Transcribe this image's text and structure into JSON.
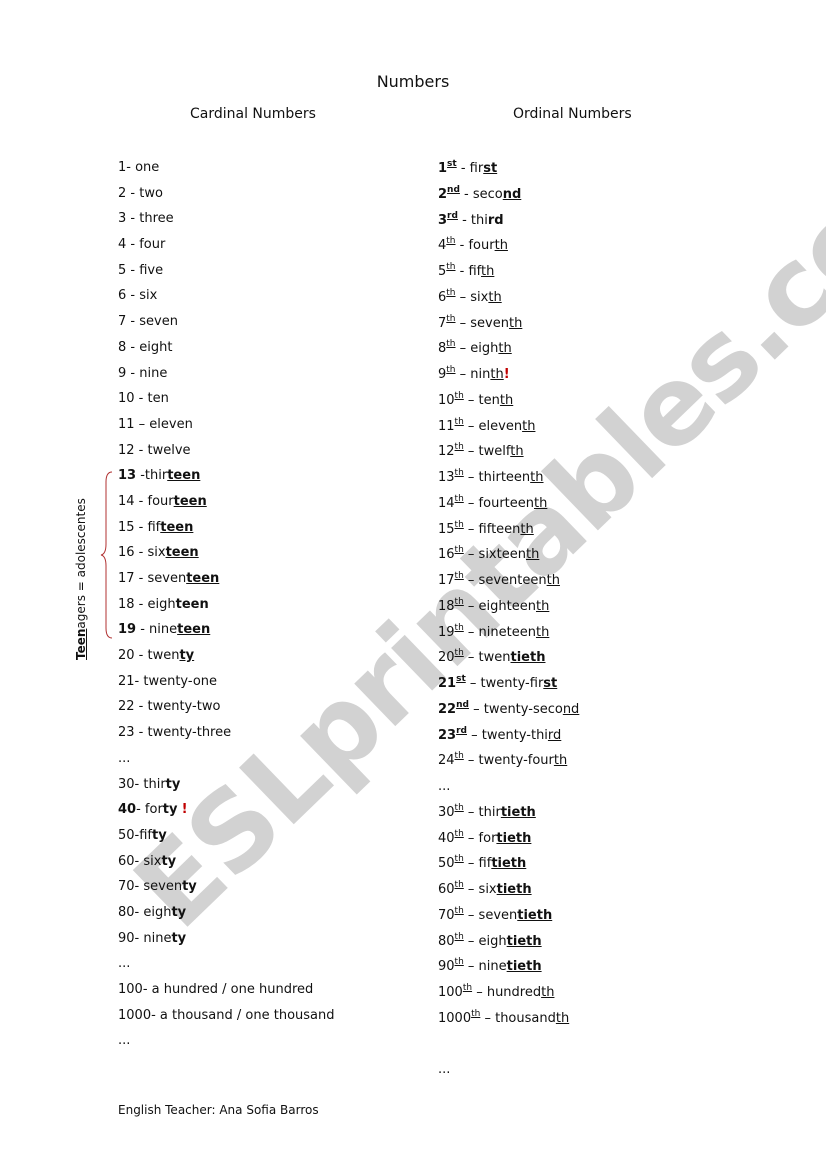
{
  "watermark": "ESLprintables.com",
  "title": "Numbers",
  "headers": {
    "cardinal": "Cardinal Numbers",
    "ordinal": "Ordinal Numbers"
  },
  "side_label": {
    "bold_part": "Teen",
    "rest": "agers = adolescentes"
  },
  "colors": {
    "exclamation": "#c00000",
    "brace": "#b03030",
    "watermark": "#d2d2d2"
  },
  "cardinal": [
    [
      {
        "t": "1- one"
      }
    ],
    [
      {
        "t": "2 - two"
      }
    ],
    [
      {
        "t": "3 - three"
      }
    ],
    [
      {
        "t": "4 - four"
      }
    ],
    [
      {
        "t": "5 - five"
      }
    ],
    [
      {
        "t": "6 - six"
      }
    ],
    [
      {
        "t": "7 - seven"
      }
    ],
    [
      {
        "t": "8 - eight"
      }
    ],
    [
      {
        "t": "9 - nine"
      }
    ],
    [
      {
        "t": "10 - ten"
      }
    ],
    [
      {
        "t": "11 – eleven"
      }
    ],
    [
      {
        "t": "12 - twelve"
      }
    ],
    [
      {
        "t": "13",
        "s": "b"
      },
      {
        "t": " -thir"
      },
      {
        "t": "teen",
        "s": "bu"
      }
    ],
    [
      {
        "t": "14 - four"
      },
      {
        "t": "teen",
        "s": "bu"
      }
    ],
    [
      {
        "t": "15 - fif"
      },
      {
        "t": "teen",
        "s": "bu"
      }
    ],
    [
      {
        "t": "16 - six"
      },
      {
        "t": "teen",
        "s": "bu"
      }
    ],
    [
      {
        "t": "17 - seven"
      },
      {
        "t": "teen",
        "s": "bu"
      }
    ],
    [
      {
        "t": "18 - eigh"
      },
      {
        "t": "teen",
        "s": "b"
      }
    ],
    [
      {
        "t": "19",
        "s": "b"
      },
      {
        "t": " - nine"
      },
      {
        "t": "teen",
        "s": "bu"
      }
    ],
    [
      {
        "t": "20 - twen"
      },
      {
        "t": "ty",
        "s": "bu"
      }
    ],
    [
      {
        "t": "21- twenty-one"
      }
    ],
    [
      {
        "t": "22 - twenty-two"
      }
    ],
    [
      {
        "t": "23 - twenty-three"
      }
    ],
    [
      {
        "t": "..."
      }
    ],
    [
      {
        "t": "30- thir"
      },
      {
        "t": "ty",
        "s": "b"
      }
    ],
    [
      {
        "t": "40",
        "s": "b"
      },
      {
        "t": "- for"
      },
      {
        "t": "ty",
        "s": "b"
      },
      {
        "t": " "
      },
      {
        "t": "!",
        "s": "x"
      }
    ],
    [
      {
        "t": "50-fif"
      },
      {
        "t": "ty",
        "s": "b"
      }
    ],
    [
      {
        "t": "60- six"
      },
      {
        "t": "ty",
        "s": "b"
      }
    ],
    [
      {
        "t": "70- seven"
      },
      {
        "t": "ty",
        "s": "b"
      }
    ],
    [
      {
        "t": "80- eigh"
      },
      {
        "t": "ty",
        "s": "b"
      }
    ],
    [
      {
        "t": "90- nine"
      },
      {
        "t": "ty",
        "s": "b"
      }
    ],
    [
      {
        "t": "..."
      }
    ],
    [
      {
        "t": "100- a hundred / one hundred"
      }
    ],
    [
      {
        "t": "1000- a thousand / one thousand"
      }
    ],
    [
      {
        "t": "..."
      }
    ]
  ],
  "ordinal": [
    [
      {
        "t": "1",
        "s": "b"
      },
      {
        "t": "st",
        "s": "bsup"
      },
      {
        "t": " - fir"
      },
      {
        "t": "st",
        "s": "bu"
      }
    ],
    [
      {
        "t": "2",
        "s": "b"
      },
      {
        "t": "nd",
        "s": "bsup"
      },
      {
        "t": " - seco"
      },
      {
        "t": "nd",
        "s": "bu"
      }
    ],
    [
      {
        "t": "3",
        "s": "b"
      },
      {
        "t": "rd",
        "s": "bsup"
      },
      {
        "t": " - thi"
      },
      {
        "t": "rd",
        "s": "b"
      }
    ],
    [
      {
        "t": "4"
      },
      {
        "t": "th",
        "s": "sup"
      },
      {
        "t": " - four"
      },
      {
        "t": "th",
        "s": "u"
      }
    ],
    [
      {
        "t": "5"
      },
      {
        "t": "th",
        "s": "sup"
      },
      {
        "t": " - fif"
      },
      {
        "t": "th",
        "s": "u"
      }
    ],
    [
      {
        "t": "6"
      },
      {
        "t": "th",
        "s": "sup"
      },
      {
        "t": " – six"
      },
      {
        "t": "th",
        "s": "u"
      }
    ],
    [
      {
        "t": "7"
      },
      {
        "t": "th",
        "s": "sup"
      },
      {
        "t": " – seven"
      },
      {
        "t": "th",
        "s": "u"
      }
    ],
    [
      {
        "t": "8"
      },
      {
        "t": "th",
        "s": "sup"
      },
      {
        "t": " – eigh"
      },
      {
        "t": "th",
        "s": "u"
      }
    ],
    [
      {
        "t": "9"
      },
      {
        "t": "th",
        "s": "sup"
      },
      {
        "t": " – nin"
      },
      {
        "t": "th",
        "s": "u"
      },
      {
        "t": "!",
        "s": "x"
      }
    ],
    [
      {
        "t": "10"
      },
      {
        "t": "th",
        "s": "sup"
      },
      {
        "t": " – ten"
      },
      {
        "t": "th",
        "s": "u"
      }
    ],
    [
      {
        "t": "11"
      },
      {
        "t": "th",
        "s": "sup"
      },
      {
        "t": " – eleven"
      },
      {
        "t": "th",
        "s": "u"
      }
    ],
    [
      {
        "t": "12"
      },
      {
        "t": "th",
        "s": "sup"
      },
      {
        "t": " – twelf"
      },
      {
        "t": "th",
        "s": "u"
      }
    ],
    [
      {
        "t": "13"
      },
      {
        "t": "th",
        "s": "sup"
      },
      {
        "t": " – thirteen"
      },
      {
        "t": "th",
        "s": "u"
      }
    ],
    [
      {
        "t": "14"
      },
      {
        "t": "th",
        "s": "sup"
      },
      {
        "t": " – fourteen"
      },
      {
        "t": "th",
        "s": "u"
      }
    ],
    [
      {
        "t": "15"
      },
      {
        "t": "th",
        "s": "sup"
      },
      {
        "t": " – fifteen"
      },
      {
        "t": "th",
        "s": "u"
      }
    ],
    [
      {
        "t": "16"
      },
      {
        "t": "th",
        "s": "sup"
      },
      {
        "t": " – sixteen"
      },
      {
        "t": "th",
        "s": "u"
      }
    ],
    [
      {
        "t": "17"
      },
      {
        "t": "th",
        "s": "sup"
      },
      {
        "t": " – seventeen"
      },
      {
        "t": "th",
        "s": "u"
      }
    ],
    [
      {
        "t": "18"
      },
      {
        "t": "th",
        "s": "sup"
      },
      {
        "t": " – eighteen"
      },
      {
        "t": "th",
        "s": "u"
      }
    ],
    [
      {
        "t": "19"
      },
      {
        "t": "th",
        "s": "sup"
      },
      {
        "t": " – nineteen"
      },
      {
        "t": "th",
        "s": "u"
      }
    ],
    [
      {
        "t": "20"
      },
      {
        "t": "th",
        "s": "sup"
      },
      {
        "t": " – twen"
      },
      {
        "t": "tieth",
        "s": "bu"
      }
    ],
    [
      {
        "t": "21",
        "s": "b"
      },
      {
        "t": "st",
        "s": "bsup"
      },
      {
        "t": " – twenty-fir"
      },
      {
        "t": "st",
        "s": "bu"
      }
    ],
    [
      {
        "t": "22",
        "s": "b"
      },
      {
        "t": "nd",
        "s": "bsup"
      },
      {
        "t": " – twenty-seco"
      },
      {
        "t": "nd",
        "s": "u"
      }
    ],
    [
      {
        "t": "23",
        "s": "b"
      },
      {
        "t": "rd",
        "s": "bsup"
      },
      {
        "t": " – twenty-thi"
      },
      {
        "t": "rd",
        "s": "u"
      }
    ],
    [
      {
        "t": "24"
      },
      {
        "t": "th",
        "s": "sup"
      },
      {
        "t": " – twenty-four"
      },
      {
        "t": "th",
        "s": "u"
      }
    ],
    [
      {
        "t": "..."
      }
    ],
    [
      {
        "t": "30"
      },
      {
        "t": "th",
        "s": "sup"
      },
      {
        "t": " – thir"
      },
      {
        "t": "tieth",
        "s": "bu"
      }
    ],
    [
      {
        "t": "40"
      },
      {
        "t": "th",
        "s": "sup"
      },
      {
        "t": " – for"
      },
      {
        "t": "tieth",
        "s": "bu"
      }
    ],
    [
      {
        "t": "50"
      },
      {
        "t": "th",
        "s": "sup"
      },
      {
        "t": " – fif"
      },
      {
        "t": "tieth",
        "s": "bu"
      }
    ],
    [
      {
        "t": "60"
      },
      {
        "t": "th",
        "s": "sup"
      },
      {
        "t": " – six"
      },
      {
        "t": "tieth",
        "s": "bu"
      }
    ],
    [
      {
        "t": "70"
      },
      {
        "t": "th",
        "s": "sup"
      },
      {
        "t": " – seven"
      },
      {
        "t": "tieth",
        "s": "bu"
      }
    ],
    [
      {
        "t": "80"
      },
      {
        "t": "th",
        "s": "sup"
      },
      {
        "t": " – eigh"
      },
      {
        "t": "tieth",
        "s": "bu"
      }
    ],
    [
      {
        "t": "90"
      },
      {
        "t": "th",
        "s": "sup"
      },
      {
        "t": " – nine"
      },
      {
        "t": "tieth",
        "s": "bu"
      }
    ],
    [
      {
        "t": "100"
      },
      {
        "t": "th",
        "s": "sup"
      },
      {
        "t": " – hundred"
      },
      {
        "t": "th",
        "s": "u"
      }
    ],
    [
      {
        "t": "1000"
      },
      {
        "t": "th",
        "s": "sup"
      },
      {
        "t": " – thousand"
      },
      {
        "t": "th",
        "s": "u"
      }
    ],
    [
      {
        "t": ""
      }
    ],
    [
      {
        "t": "..."
      }
    ]
  ],
  "footer": "English Teacher: Ana Sofia Barros"
}
